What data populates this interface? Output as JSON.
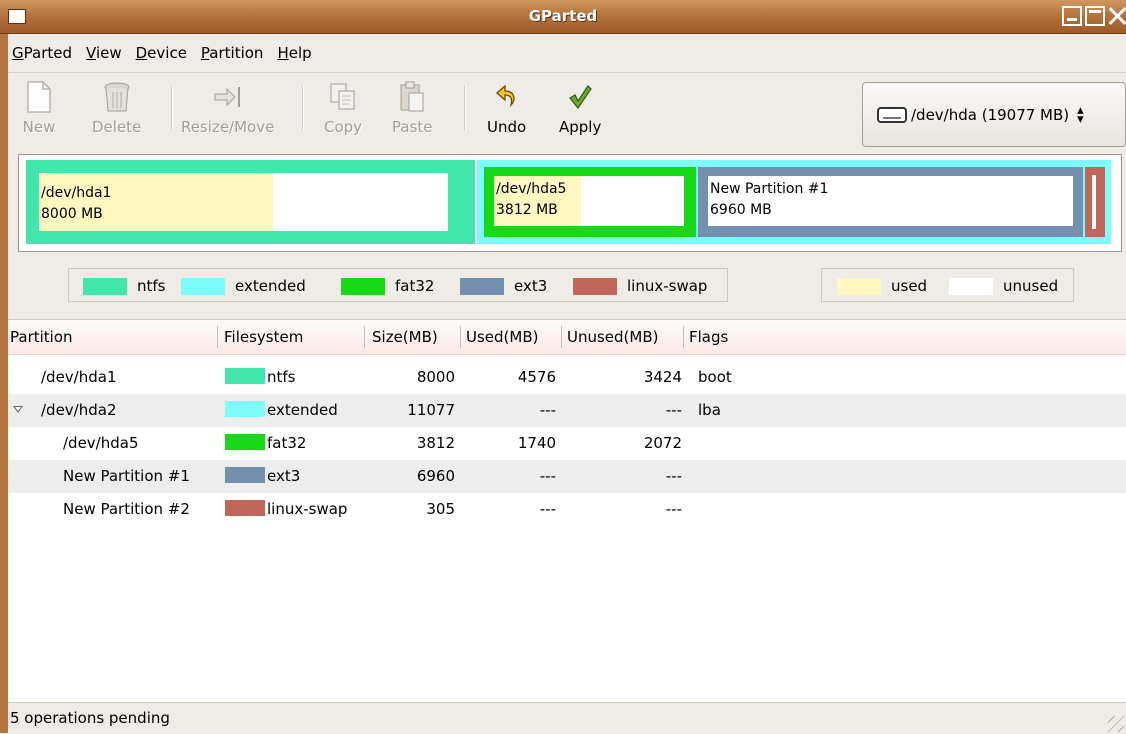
{
  "window": {
    "title": "GParted"
  },
  "menubar": [
    {
      "u": "G",
      "rest": "Parted"
    },
    {
      "u": "V",
      "rest": "iew"
    },
    {
      "u": "D",
      "rest": "evice"
    },
    {
      "u": "P",
      "rest": "artition"
    },
    {
      "u": "H",
      "rest": "elp"
    }
  ],
  "toolbar": {
    "new": "New",
    "delete": "Delete",
    "resize_move": "Resize/Move",
    "copy": "Copy",
    "paste": "Paste",
    "undo": "Undo",
    "apply": "Apply"
  },
  "device": {
    "label": "/dev/hda (19077 MB)"
  },
  "diskmap": {
    "hda1": {
      "name": "/dev/hda1",
      "size": "8000 MB",
      "used_fraction": 0.572
    },
    "hda5": {
      "name": "/dev/hda5",
      "size": "3812 MB",
      "used_fraction": 0.456
    },
    "new1": {
      "name": "New Partition #1",
      "size": "6960 MB"
    }
  },
  "legend": {
    "ntfs": "ntfs",
    "extended": "extended",
    "fat32": "fat32",
    "ext3": "ext3",
    "linux_swap": "linux-swap",
    "used": "used",
    "unused": "unused"
  },
  "colors": {
    "ntfs": "#42e5ac",
    "extended": "#7dfcfe",
    "fat32": "#18d918",
    "ext3": "#7590ae",
    "linux_swap": "#c1665a",
    "used": "#fff8c0",
    "unused": "#ffffff"
  },
  "columns": {
    "partition": "Partition",
    "filesystem": "Filesystem",
    "size": "Size(MB)",
    "used": "Used(MB)",
    "unused": "Unused(MB)",
    "flags": "Flags"
  },
  "rows": [
    {
      "partition": "/dev/hda1",
      "filesystem": "ntfs",
      "size": "8000",
      "used": "4576",
      "unused": "3424",
      "flags": "boot"
    },
    {
      "partition": "/dev/hda2",
      "filesystem": "extended",
      "size": "11077",
      "used": "---",
      "unused": "---",
      "flags": "lba"
    },
    {
      "partition": "/dev/hda5",
      "filesystem": "fat32",
      "size": "3812",
      "used": "1740",
      "unused": "2072",
      "flags": ""
    },
    {
      "partition": "New Partition #1",
      "filesystem": "ext3",
      "size": "6960",
      "used": "---",
      "unused": "---",
      "flags": ""
    },
    {
      "partition": "New Partition #2",
      "filesystem": "linux-swap",
      "size": "305",
      "used": "---",
      "unused": "---",
      "flags": ""
    }
  ],
  "status": {
    "text": "5 operations pending"
  }
}
